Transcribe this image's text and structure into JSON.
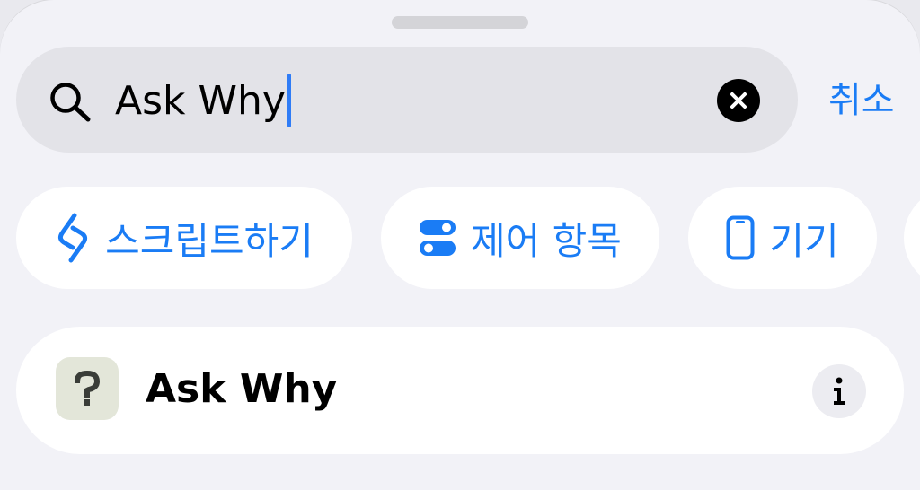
{
  "search": {
    "query": "Ask Why",
    "cancel_label": "취소"
  },
  "chips": [
    {
      "label": "스크립트하기",
      "icon": "scripting-icon"
    },
    {
      "label": "제어 항목",
      "icon": "toggle-controls-icon"
    },
    {
      "label": "기기",
      "icon": "device-phone-icon"
    },
    {
      "label": "",
      "icon": "partial-chip"
    }
  ],
  "results": [
    {
      "title": "Ask Why",
      "icon": "question-mark-app-icon"
    }
  ],
  "colors": {
    "accent": "#1a7cf5",
    "background": "#f2f2f7",
    "search_bar": "#e3e3e8",
    "caret": "#2f7cf6"
  }
}
